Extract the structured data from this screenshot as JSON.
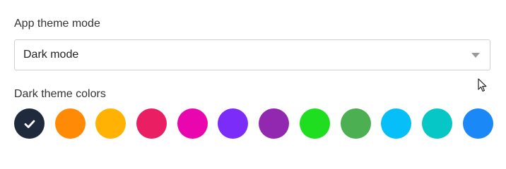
{
  "theme_mode": {
    "label": "App theme mode",
    "selected": "Dark mode"
  },
  "dark_theme_colors": {
    "label": "Dark theme colors",
    "selected_index": 0,
    "swatches": [
      {
        "name": "navy",
        "color": "#1f2a3c"
      },
      {
        "name": "orange",
        "color": "#ff8a06"
      },
      {
        "name": "amber",
        "color": "#ffb203"
      },
      {
        "name": "crimson",
        "color": "#ea1f63"
      },
      {
        "name": "magenta",
        "color": "#ea06ae"
      },
      {
        "name": "violet",
        "color": "#7b2cf8"
      },
      {
        "name": "purple",
        "color": "#9328b0"
      },
      {
        "name": "green",
        "color": "#1fdd1f"
      },
      {
        "name": "muted-green",
        "color": "#4caf52"
      },
      {
        "name": "sky-blue",
        "color": "#06bff8"
      },
      {
        "name": "teal",
        "color": "#06c6c6"
      },
      {
        "name": "blue",
        "color": "#1a88f6"
      }
    ]
  },
  "icons": {
    "check": "check-icon",
    "dropdown": "triangle-down-icon",
    "cursor": "mouse-pointer-icon"
  }
}
